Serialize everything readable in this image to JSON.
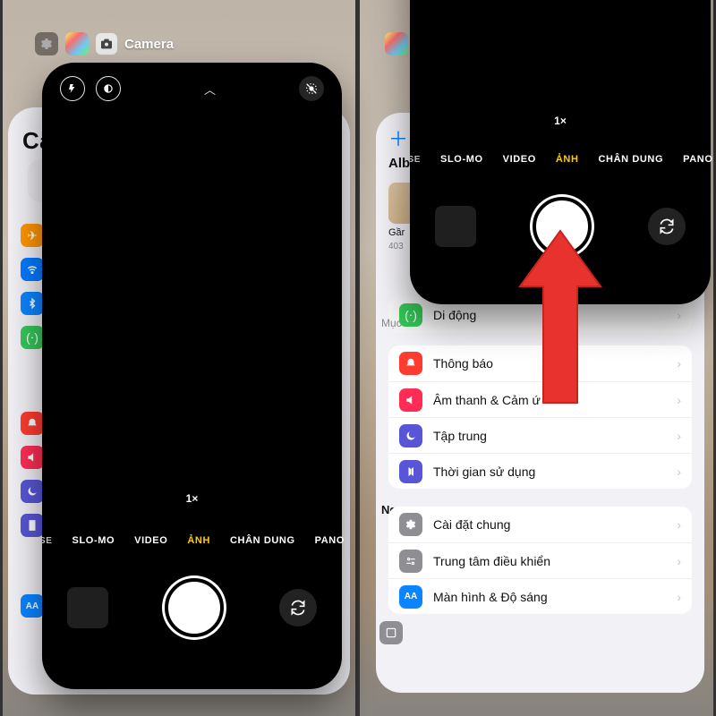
{
  "left": {
    "switcher": {
      "app_label": "Camera"
    },
    "settings_peek": {
      "heading": "Cài"
    },
    "camera": {
      "zoom": "1×",
      "modes": {
        "cut": "SE",
        "m1": "SLO-MO",
        "m2": "VIDEO",
        "active": "ẢNH",
        "m3": "CHÂN DUNG",
        "m4": "PANO"
      }
    }
  },
  "right": {
    "settings": {
      "heading": "Al",
      "sub": "Alb",
      "thumb_caption": "Gầr",
      "thumb_sub": "403",
      "section_muc": "Mục",
      "section_ng": "Ng",
      "rows_a": {
        "r0": "Di động",
        "r1": "Thông báo",
        "r2": "Âm thanh & Cảm ứ",
        "r3": "Tập trung",
        "r4": "Thời gian sử dụng"
      },
      "rows_b": {
        "r0": "Cài đặt chung",
        "r1": "Trung tâm điều khiển",
        "r2": "Màn hình & Độ sáng"
      }
    },
    "camera": {
      "zoom": "1×",
      "modes": {
        "cut": "SE",
        "m1": "SLO-MO",
        "m2": "VIDEO",
        "active": "ẢNH",
        "m3": "CHÂN DUNG",
        "m4": "PANO"
      }
    }
  }
}
